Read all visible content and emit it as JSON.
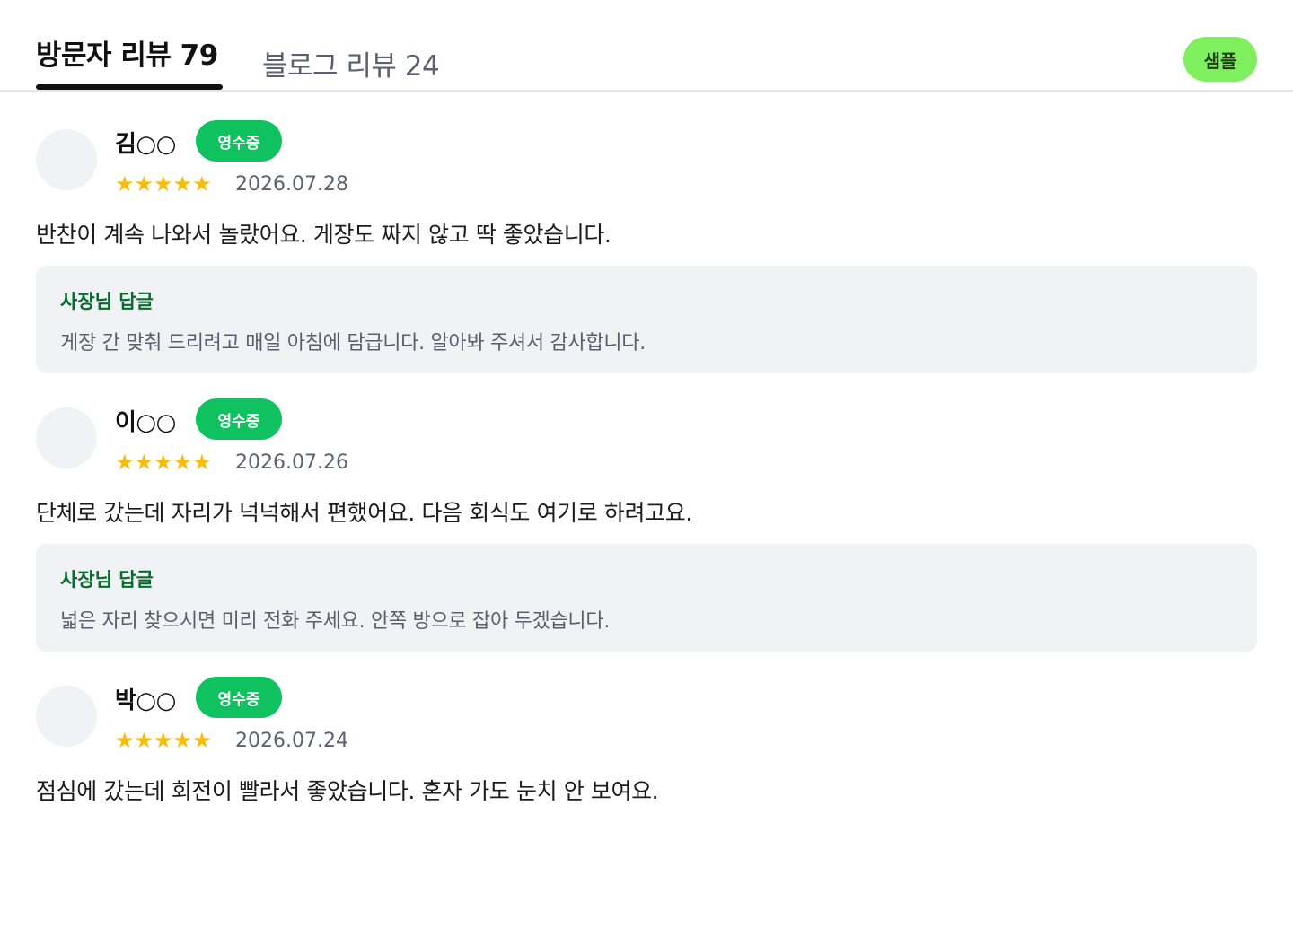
{
  "tabs": {
    "visitor_reviews": "방문자 리뷰 79",
    "blog_reviews": "블로그 리뷰 24"
  },
  "sample_badge": "샘플",
  "colors": {
    "receipt_badge": "#0fc25f",
    "sample_badge": "#7fef5f",
    "star": "#f7bd0c",
    "reply_title": "#0a6b2e"
  },
  "reviews": [
    {
      "author": "김○○",
      "badge": "영수증",
      "rating": 5,
      "stars": "★★★★★",
      "date": "2026.07.28",
      "text": "반찬이 계속 나와서 놀랐어요. 게장도 짜지 않고 딱 좋았습니다.",
      "reply": {
        "title": "사장님 답글",
        "text": "게장 간 맞춰 드리려고 매일 아침에 담급니다. 알아봐 주셔서 감사합니다."
      }
    },
    {
      "author": "이○○",
      "badge": "영수증",
      "rating": 5,
      "stars": "★★★★★",
      "date": "2026.07.26",
      "text": "단체로 갔는데 자리가 넉넉해서 편했어요. 다음 회식도 여기로 하려고요.",
      "reply": {
        "title": "사장님 답글",
        "text": "넓은 자리 찾으시면 미리 전화 주세요. 안쪽 방으로 잡아 두겠습니다."
      }
    },
    {
      "author": "박○○",
      "badge": "영수증",
      "rating": 5,
      "stars": "★★★★★",
      "date": "2026.07.24",
      "text": "점심에 갔는데 회전이 빨라서 좋았습니다. 혼자 가도 눈치 안 보여요."
    }
  ]
}
